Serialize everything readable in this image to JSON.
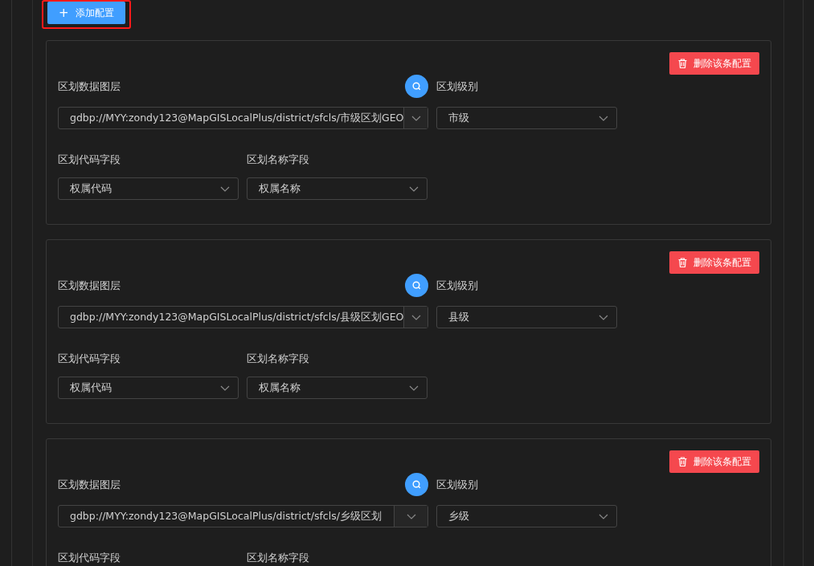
{
  "add_button": {
    "icon": "+",
    "label": "添加配置",
    "highlighted": true
  },
  "configs": [
    {
      "delete_label": "删除该条配置",
      "layer_label": "区划数据图层",
      "layer_value": "gdbp://MYY:zondy123@MapGISLocalPlus/district/sfcls/市级区划GEO",
      "level_label": "区划级别",
      "level_value": "市级",
      "code_label": "区划代码字段",
      "code_value": "权属代码",
      "name_label": "区划名称字段",
      "name_value": "权属名称"
    },
    {
      "delete_label": "删除该条配置",
      "layer_label": "区划数据图层",
      "layer_value": "gdbp://MYY:zondy123@MapGISLocalPlus/district/sfcls/县级区划GEO",
      "level_label": "区划级别",
      "level_value": "县级",
      "code_label": "区划代码字段",
      "code_value": "权属代码",
      "name_label": "区划名称字段",
      "name_value": "权属名称"
    },
    {
      "delete_label": "删除该条配置",
      "layer_label": "区划数据图层",
      "layer_value": "gdbp://MYY:zondy123@MapGISLocalPlus/district/sfcls/乡级区划",
      "level_label": "区划级别",
      "level_value": "乡级",
      "code_label": "区划代码字段",
      "name_label": "区划名称字段"
    }
  ]
}
